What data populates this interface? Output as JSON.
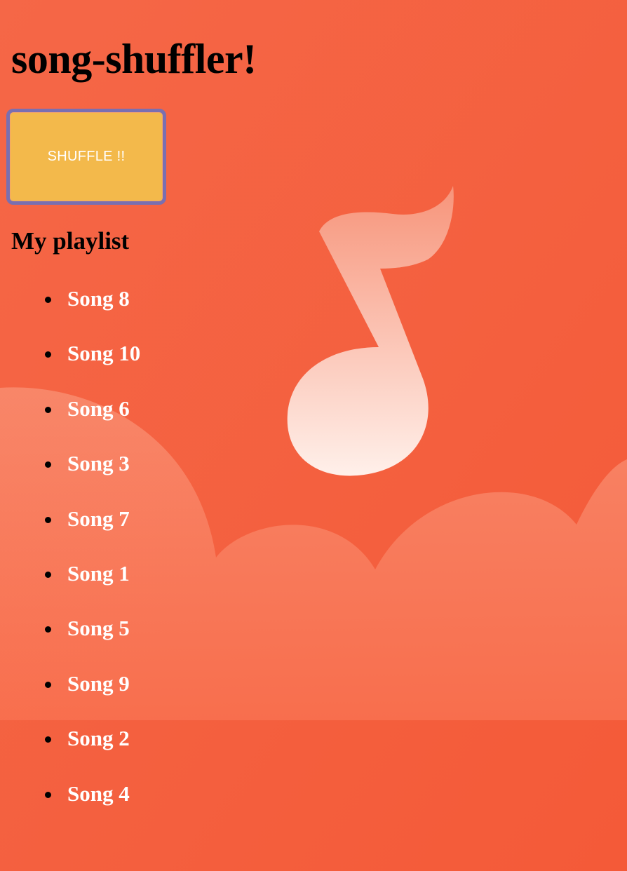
{
  "app": {
    "title": "song-shuffler!"
  },
  "controls": {
    "shuffle_label": "SHUFFLE !!"
  },
  "playlist": {
    "heading": "My playlist",
    "songs": [
      "Song 8",
      "Song 10",
      "Song 6",
      "Song 3",
      "Song 7",
      "Song 1",
      "Song 5",
      "Song 9",
      "Song 2",
      "Song 4"
    ]
  },
  "background": {
    "icon": "music-note-icon",
    "colors": {
      "base": "#f45f3f",
      "cloud": "#f9876a",
      "note": "#fde6dc"
    }
  },
  "colors": {
    "button_fill": "#f3b94b",
    "button_border": "#7a6fb0",
    "song_text": "#ffffff",
    "heading_text": "#000000"
  }
}
